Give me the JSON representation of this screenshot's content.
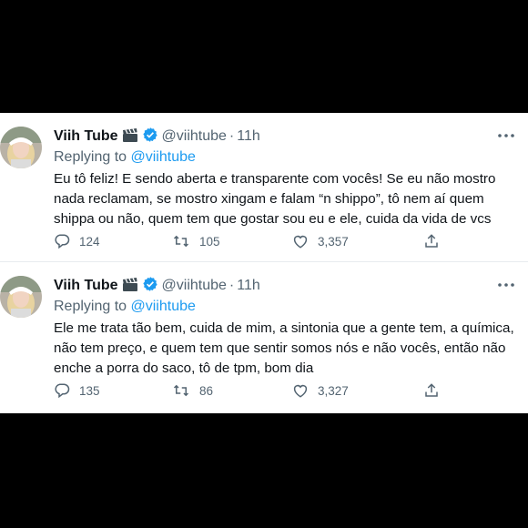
{
  "colors": {
    "accent": "#1d9bf0",
    "muted": "#536471",
    "text": "#0f1419",
    "frame": "#000000"
  },
  "tweets": [
    {
      "author": "Viih Tube",
      "handle": "@viihtube",
      "separator": "·",
      "time": "11h",
      "replying_prefix": "Replying to",
      "replying_to": "@viihtube",
      "text_lines": [
        "Eu tô feliz! E sendo aberta e transparente com vocês! Se eu não mostro",
        "nada reclamam, se mostro xingam e falam “n shippo”, tô nem aí quem",
        "shippa ou não, quem tem que gostar sou eu e ele, cuida da vida de vcs"
      ],
      "replies": "124",
      "retweets": "105",
      "likes": "3,357",
      "icons": [
        "avatar",
        "clapper-board-icon",
        "verified-badge-icon",
        "more-icon",
        "reply-icon",
        "retweet-icon",
        "like-icon",
        "share-icon"
      ]
    },
    {
      "author": "Viih Tube",
      "handle": "@viihtube",
      "separator": "·",
      "time": "11h",
      "replying_prefix": "Replying to",
      "replying_to": "@viihtube",
      "text_lines": [
        "Ele me trata tão bem, cuida de mim, a sintonia que a gente tem, a química,",
        "não tem preço, e quem tem que sentir somos nós e não vocês, então não",
        "enche a porra do saco, tô de tpm, bom dia"
      ],
      "replies": "135",
      "retweets": "86",
      "likes": "3,327",
      "icons": [
        "avatar",
        "clapper-board-icon",
        "verified-badge-icon",
        "more-icon",
        "reply-icon",
        "retweet-icon",
        "like-icon",
        "share-icon"
      ]
    }
  ]
}
